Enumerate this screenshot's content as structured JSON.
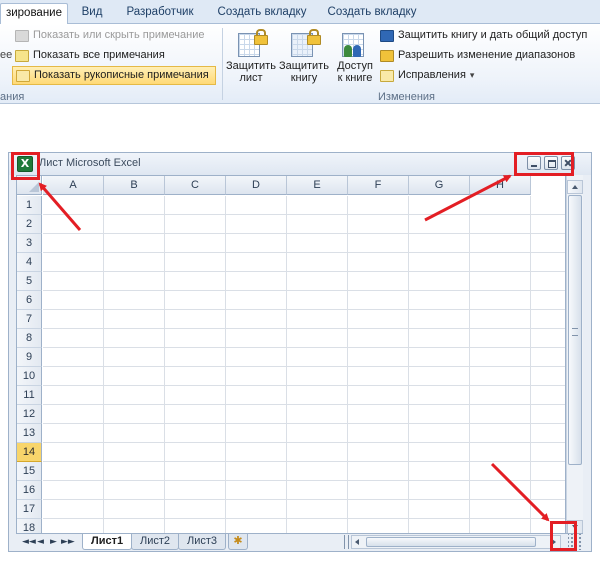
{
  "ribbon": {
    "tabs": [
      {
        "label": "зирование",
        "active": true
      },
      {
        "label": "Вид",
        "active": false
      },
      {
        "label": "Разработчик",
        "active": false
      },
      {
        "label": "Создать вкладку",
        "active": false
      },
      {
        "label": "Создать вкладку",
        "active": false
      }
    ],
    "notes_group": {
      "items": [
        {
          "label": "Показать или скрыть примечание",
          "state": "disabled",
          "icon": "note-icon"
        },
        {
          "label": "Показать все примечания",
          "state": "normal",
          "icon": "notes-icon"
        },
        {
          "label": "Показать рукописные примечания",
          "state": "selected",
          "icon": "pen-icon"
        }
      ],
      "left_fragment": "ее",
      "caption_fragment": "ания"
    },
    "changes_group": {
      "big_buttons": [
        {
          "line1": "Защитить",
          "line2": "лист",
          "icon": "protect-sheet-icon"
        },
        {
          "line1": "Защитить",
          "line2": "книгу",
          "icon": "protect-workbook-icon"
        },
        {
          "line1": "Доступ",
          "line2": "к книге",
          "icon": "share-workbook-icon"
        }
      ],
      "small_items": [
        {
          "label": "Защитить книгу и дать общий доступ",
          "icon": "protect-share-icon"
        },
        {
          "label": "Разрешить изменение диапазонов",
          "icon": "allow-ranges-icon"
        },
        {
          "label": "Исправления",
          "icon": "track-changes-icon",
          "dropdown": "▾"
        }
      ],
      "caption": "Изменения"
    }
  },
  "window": {
    "title": "Лист Microsoft Excel",
    "icon_glyph": "X",
    "columns": [
      "A",
      "B",
      "C",
      "D",
      "E",
      "F",
      "G",
      "H"
    ],
    "rows": [
      "1",
      "2",
      "3",
      "4",
      "5",
      "6",
      "7",
      "8",
      "9",
      "10",
      "11",
      "12",
      "13",
      "14",
      "15",
      "16",
      "17",
      "18"
    ],
    "active_row": "14",
    "sheets": [
      {
        "label": "Лист1",
        "active": true
      },
      {
        "label": "Лист2",
        "active": false
      },
      {
        "label": "Лист3",
        "active": false
      }
    ],
    "nav_glyphs": [
      "◄◄",
      "◄",
      "►",
      "►►"
    ],
    "new_sheet_glyph": "✱"
  },
  "annotations": {
    "color": "#e31e24"
  }
}
